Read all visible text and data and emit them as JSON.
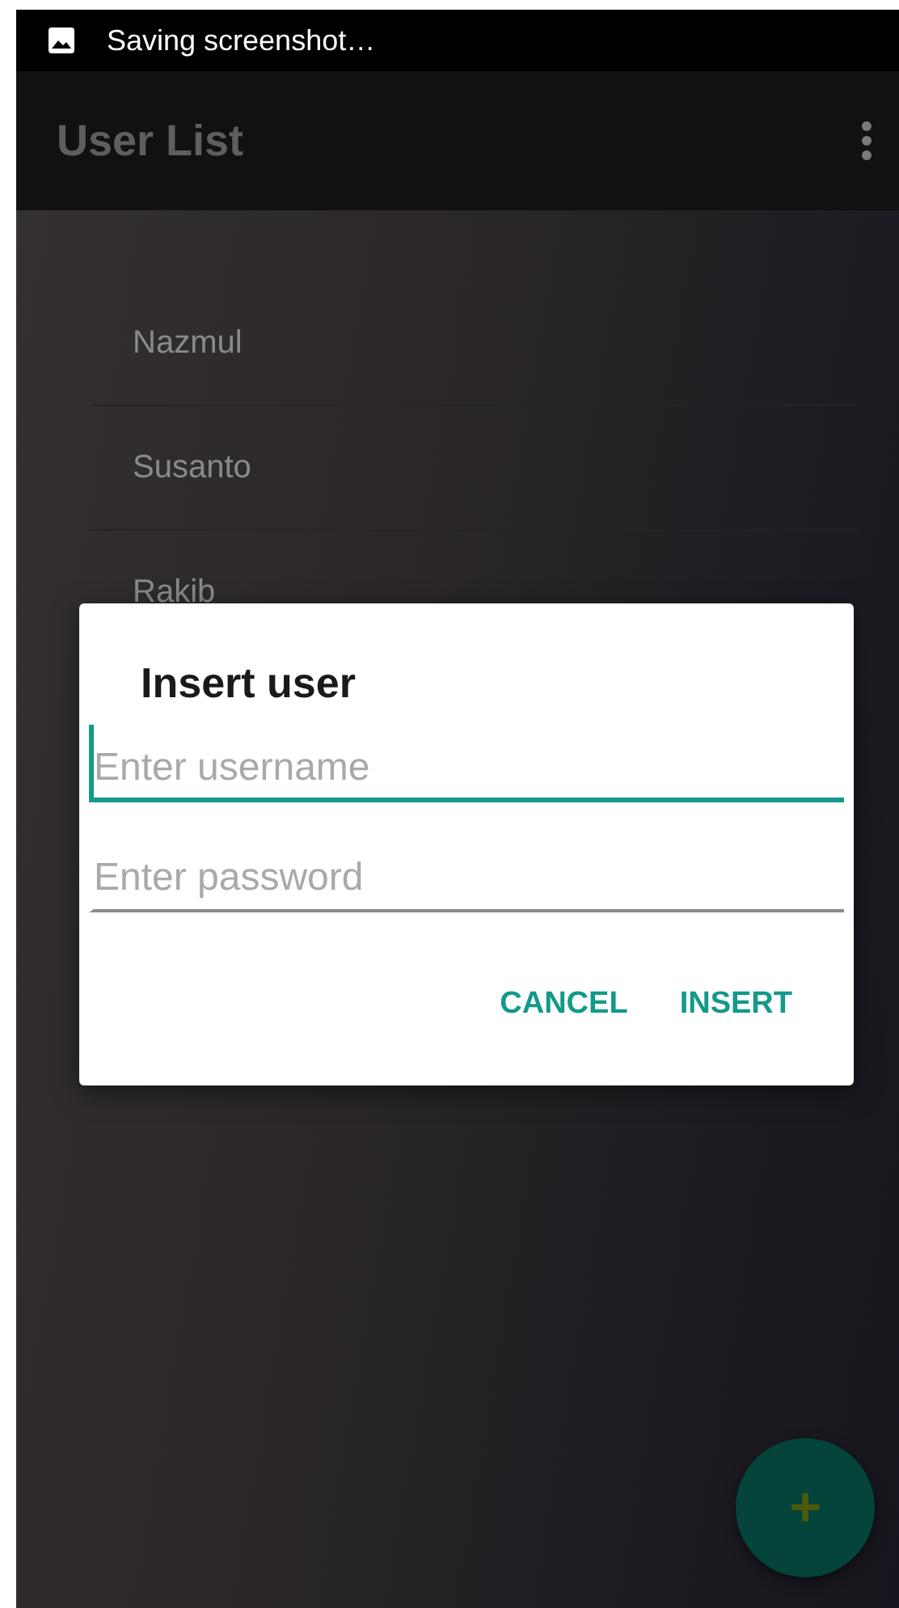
{
  "status_bar": {
    "text": "Saving screenshot…"
  },
  "app_bar": {
    "title": "User List"
  },
  "users": [
    {
      "name": "Nazmul"
    },
    {
      "name": "Susanto"
    },
    {
      "name": "Rakib"
    }
  ],
  "dialog": {
    "title": "Insert user",
    "fields": [
      {
        "placeholder": "Enter username",
        "focused": true
      },
      {
        "placeholder": "Enter password",
        "focused": false
      }
    ],
    "buttons": [
      "CANCEL",
      "INSERT"
    ]
  },
  "fab": {
    "label": "+"
  }
}
